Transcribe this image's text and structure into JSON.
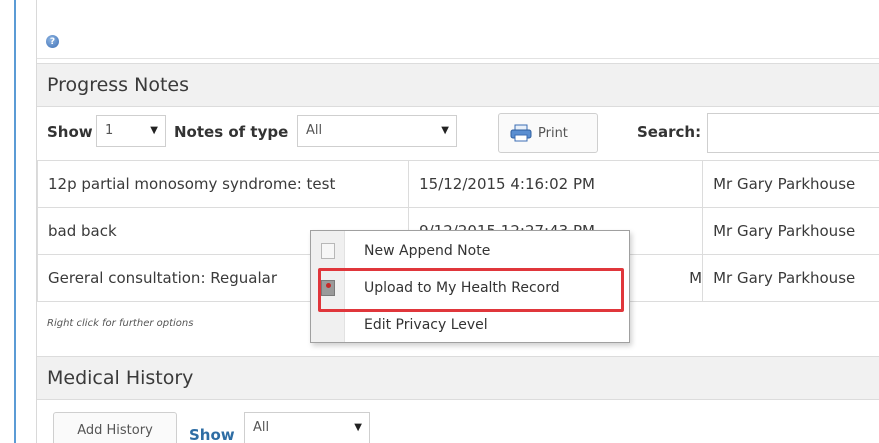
{
  "help": {
    "icon": "help-icon"
  },
  "progress_notes": {
    "title": "Progress Notes",
    "show_label": "Show",
    "show_value": "1",
    "notes_type_label": "Notes of type",
    "notes_type_value": "All",
    "print_label": "Print",
    "search_label": "Search:",
    "search_value": "",
    "rows": [
      {
        "title": "12p partial monosomy syndrome: test",
        "datetime": "15/12/2015 4:16:02 PM",
        "author": "Mr Gary Parkhouse"
      },
      {
        "title": "bad back",
        "datetime": "9/12/2015 12:27:43 PM",
        "author": "Mr Gary Parkhouse"
      },
      {
        "title": "Gereral consultation: Regualar",
        "datetime": "M",
        "author": "Mr Gary Parkhouse"
      }
    ],
    "footnote": "Right click for further options"
  },
  "context_menu": {
    "items": [
      {
        "label": "New Append Note",
        "icon": "document-icon"
      },
      {
        "label": "Upload to My Health Record",
        "icon": "upload-icon"
      },
      {
        "label": "Edit Privacy Level",
        "icon": ""
      }
    ]
  },
  "medical_history": {
    "title": "Medical History",
    "add_label": "Add History",
    "show_label": "Show",
    "show_value": "All"
  },
  "colors": {
    "accent": "#5b9bd5",
    "highlight": "#e0363b",
    "link_blue": "#2e6da4"
  }
}
